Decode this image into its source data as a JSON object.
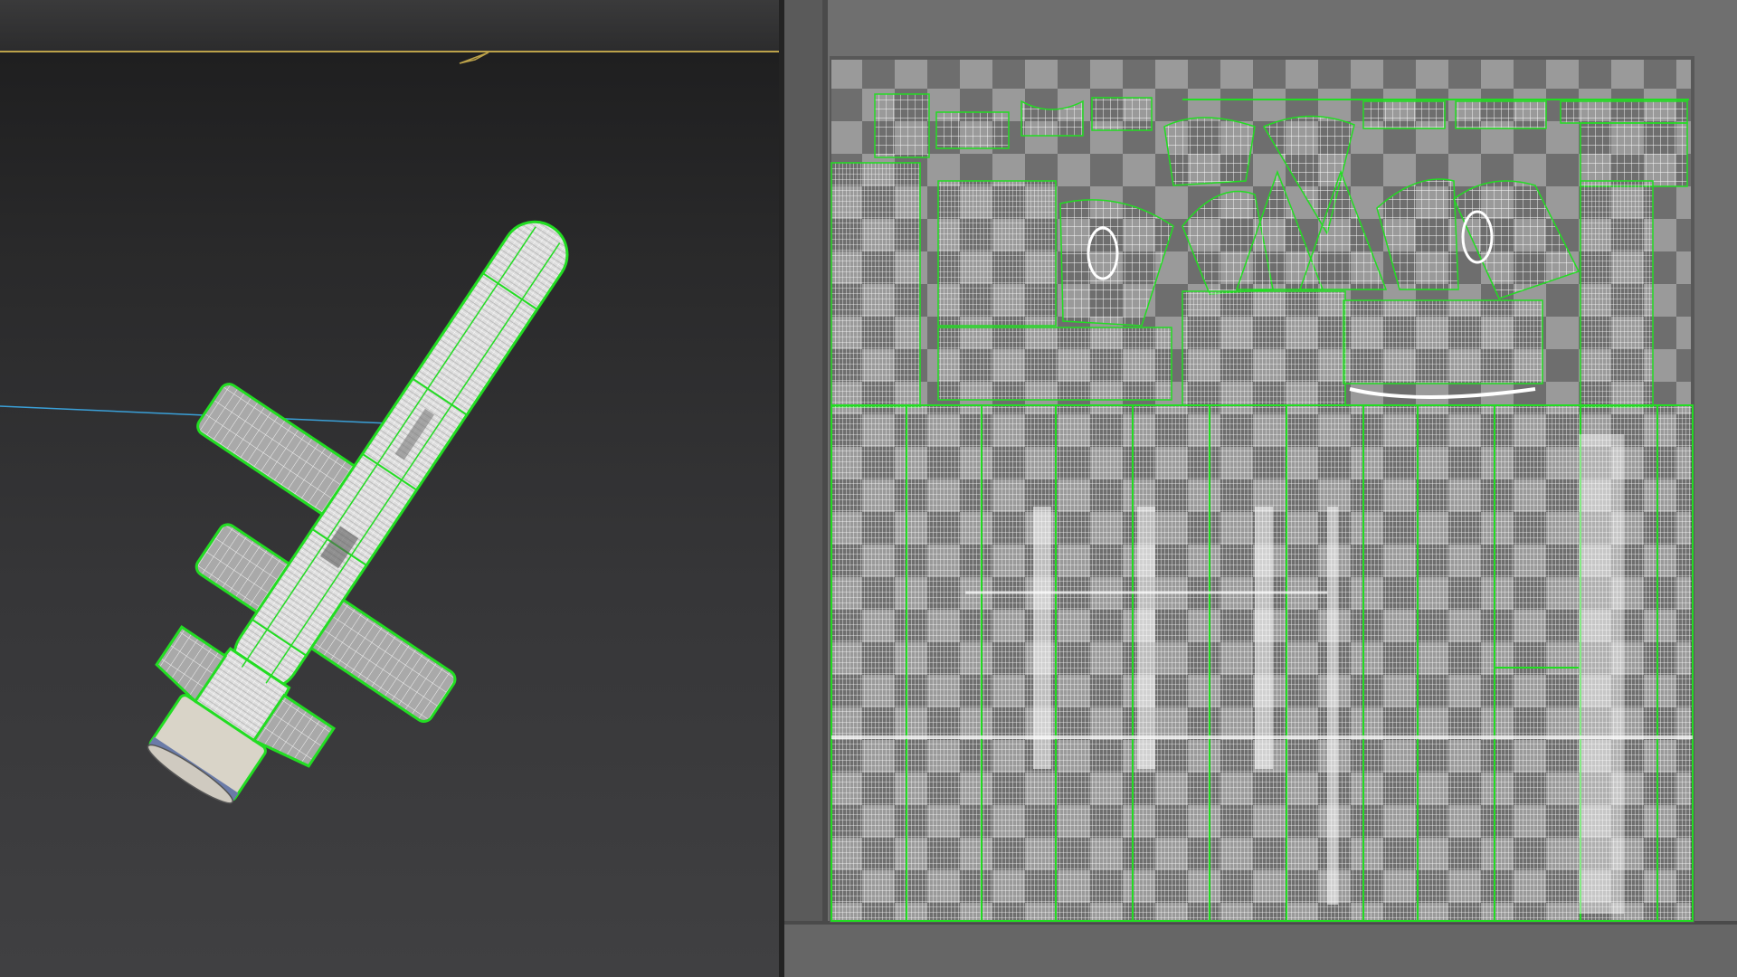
{
  "colors": {
    "viewport_bg_top": "#1c1c1d",
    "viewport_bg_bottom": "#404042",
    "selection_green": "#22dd22",
    "wire_white": "#ffffff",
    "checker_light": "#9a9a9a",
    "checker_dark": "#6e6e6e",
    "grid_axis_blue": "#3aa0d8",
    "viewport_border_yellow": "#bca24a"
  },
  "icons": {
    "viewcube": "viewcube-icon"
  }
}
